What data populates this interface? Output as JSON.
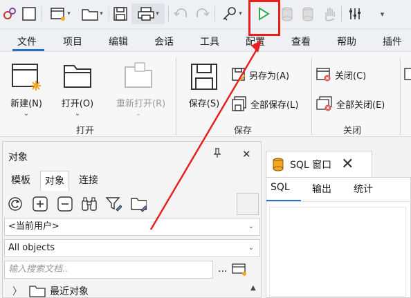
{
  "menu_tabs": [
    "文件",
    "项目",
    "编辑",
    "会话",
    "工具",
    "配置",
    "查看",
    "帮助",
    "插件"
  ],
  "ribbon": {
    "new": "新建(N)",
    "open": "打开(O)",
    "reopen": "重新打开(R)",
    "save": "保存(S)",
    "save_as": "另存为(A)",
    "save_all": "全部保存(L)",
    "close": "关闭(C)",
    "close_all": "全部关闭(E)",
    "group_open": "打开",
    "group_save": "保存",
    "group_close": "关闭"
  },
  "object_pane": {
    "title": "对象",
    "pin": "ꟷ",
    "close": "✕",
    "tabs": [
      "模板",
      "对象",
      "连接"
    ],
    "user_combo": "<当前用户>",
    "type_combo": "All objects",
    "search_placeholder": "输入搜索文档..",
    "search_more": "...",
    "tree_recent": "最近对象"
  },
  "sql_pane": {
    "tab_label": "SQL 窗口",
    "subtabs": [
      "SQL",
      "输出",
      "统计"
    ]
  },
  "colors": {
    "highlight": "#e8201d",
    "run_green": "#2fa84f",
    "accent": "#2b6cc4"
  }
}
